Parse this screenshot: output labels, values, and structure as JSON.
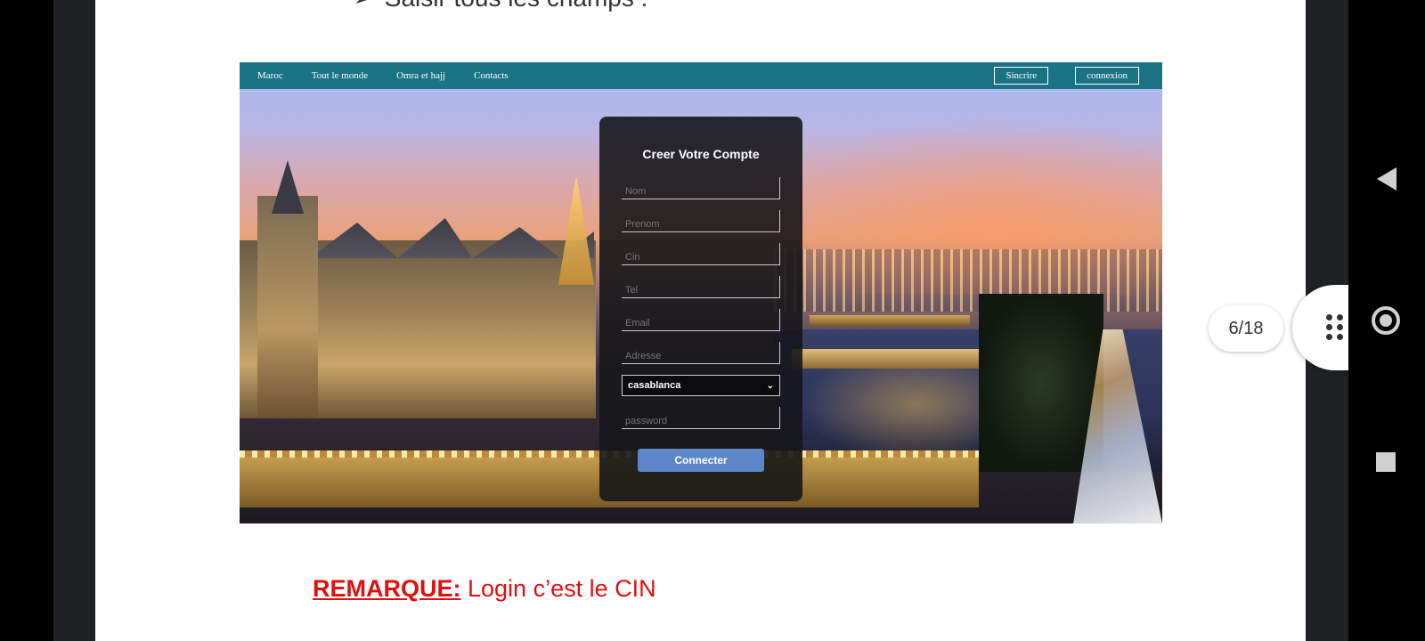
{
  "viewer": {
    "page_indicator": "6/18"
  },
  "document": {
    "bullet_text": "Saisir tous les champs :",
    "remark_label": "REMARQUE:",
    "remark_text": " Login c’est le CIN"
  },
  "site": {
    "nav": {
      "items": [
        "Maroc",
        "Tout le monde",
        "Omra et hajj",
        "Contacts"
      ],
      "signup": "Sincrire",
      "login": "connexion"
    },
    "form": {
      "title": "Creer Votre Compte",
      "placeholders": {
        "nom": "Nom",
        "prenom": "Prenom",
        "cin": "Cin",
        "tel": "Tel",
        "email": "Email",
        "adresse": "Adresse",
        "password": "password"
      },
      "city_select": "casablanca",
      "submit": "Connecter"
    }
  },
  "colors": {
    "navbar": "#1a7384",
    "button": "#5c86c8",
    "remark": "#e01010"
  }
}
